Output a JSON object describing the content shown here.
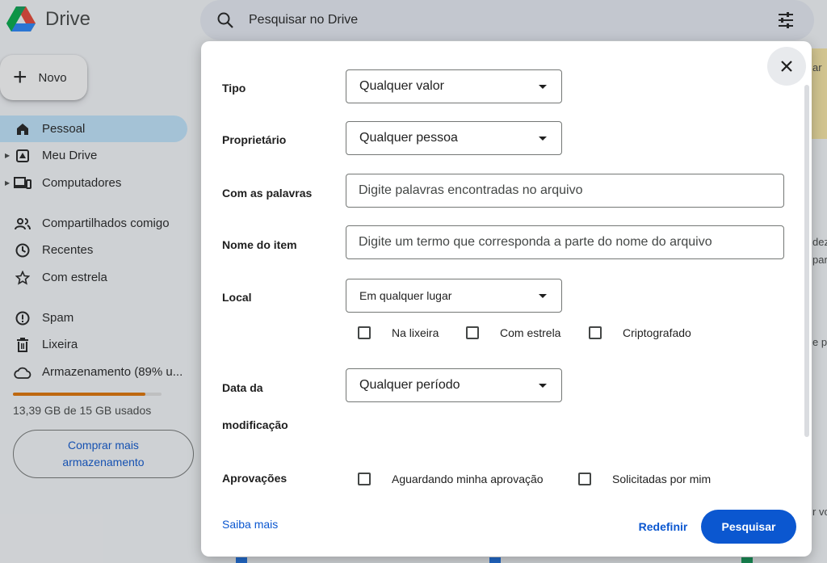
{
  "app": {
    "name": "Drive"
  },
  "sidebar": {
    "new_label": "Novo",
    "items": [
      {
        "label": "Pessoal",
        "icon": "home-icon",
        "active": true
      },
      {
        "label": "Meu Drive",
        "icon": "my-drive-icon",
        "expandable": true
      },
      {
        "label": "Computadores",
        "icon": "computers-icon",
        "expandable": true
      },
      {
        "label": "Compartilhados comigo",
        "icon": "shared-icon"
      },
      {
        "label": "Recentes",
        "icon": "clock-icon"
      },
      {
        "label": "Com estrela",
        "icon": "star-icon"
      },
      {
        "label": "Spam",
        "icon": "spam-icon"
      },
      {
        "label": "Lixeira",
        "icon": "trash-icon"
      },
      {
        "label": "Armazenamento (89% u...",
        "icon": "cloud-icon"
      }
    ],
    "storage": {
      "used_fraction": 0.89,
      "text": "13,39 GB de 15 GB usados",
      "bar_color": "#e37400"
    },
    "buy_line1": "Comprar mais",
    "buy_line2": "armazenamento"
  },
  "search": {
    "placeholder": "Pesquisar no Drive"
  },
  "background_peek": {
    "t1": "ar",
    "t2": "dez",
    "t3": "part",
    "t4": "e pr",
    "t5": "r vo"
  },
  "dialog": {
    "type": {
      "label": "Tipo",
      "value": "Qualquer valor"
    },
    "owner": {
      "label": "Proprietário",
      "value": "Qualquer pessoa"
    },
    "words": {
      "label": "Com as palavras",
      "placeholder": "Digite palavras encontradas no arquivo"
    },
    "item_name": {
      "label": "Nome do item",
      "placeholder": "Digite um termo que corresponda a parte do nome do arquivo"
    },
    "location": {
      "label": "Local",
      "value": "Em qualquer lugar",
      "options": [
        {
          "label": "Na lixeira",
          "checked": false
        },
        {
          "label": "Com estrela",
          "checked": false
        },
        {
          "label": "Criptografado",
          "checked": false
        }
      ]
    },
    "modified": {
      "label_line1": "Data da",
      "label_line2": "modificação",
      "value": "Qualquer período"
    },
    "approvals": {
      "label": "Aprovações",
      "options": [
        {
          "label": "Aguardando minha aprovação",
          "checked": false
        },
        {
          "label": "Solicitadas por mim",
          "checked": false
        }
      ]
    },
    "learn_more": "Saiba mais",
    "reset": "Redefinir",
    "submit": "Pesquisar"
  },
  "colors": {
    "accent": "#0b57d0",
    "nav_active": "#c2e7ff",
    "storage": "#e37400"
  }
}
